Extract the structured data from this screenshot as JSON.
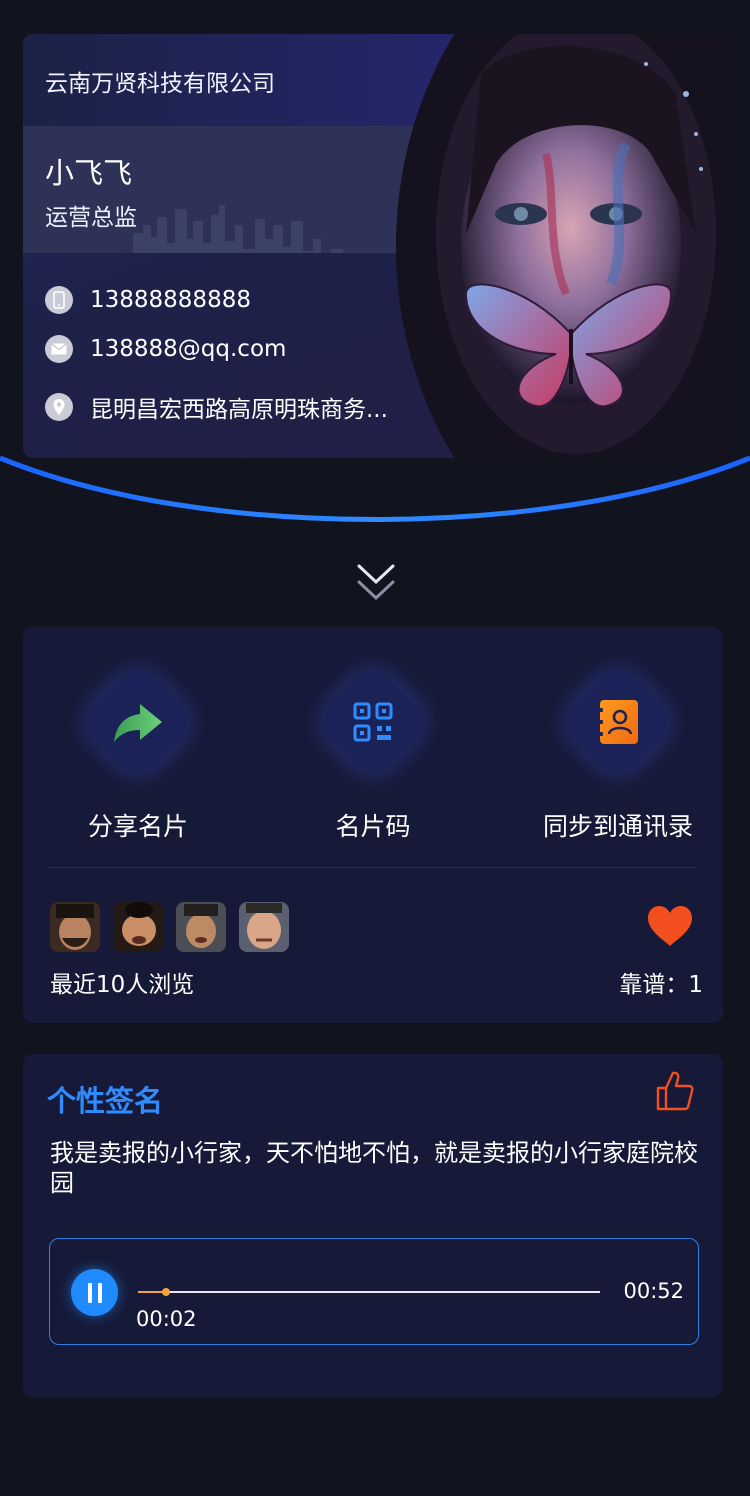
{
  "card": {
    "company": "云南万贤科技有限公司",
    "name": "小飞飞",
    "title": "运营总监",
    "phone": "13888888888",
    "email": "138888@qq.com",
    "address": "昆明昌宏西路高原明珠商务..."
  },
  "actions": [
    {
      "label": "分享名片",
      "icon": "share-arrow-icon"
    },
    {
      "label": "名片码",
      "icon": "qr-code-icon"
    },
    {
      "label": "同步到通讯录",
      "icon": "contact-book-icon"
    }
  ],
  "visitors": {
    "label": "最近10人浏览",
    "avatar_count_shown": 4
  },
  "reliable": {
    "label": "靠谱：1"
  },
  "signature": {
    "title": "个性签名",
    "text": "我是卖报的小行家，天不怕地不怕，就是卖报的小行家庭院校园"
  },
  "player": {
    "current": "00:02",
    "total": "00:52",
    "progress": 0.06,
    "state": "playing"
  },
  "colors": {
    "accent": "#2f8cff",
    "heart": "#f24e1e",
    "progress": "#f5a13a"
  }
}
